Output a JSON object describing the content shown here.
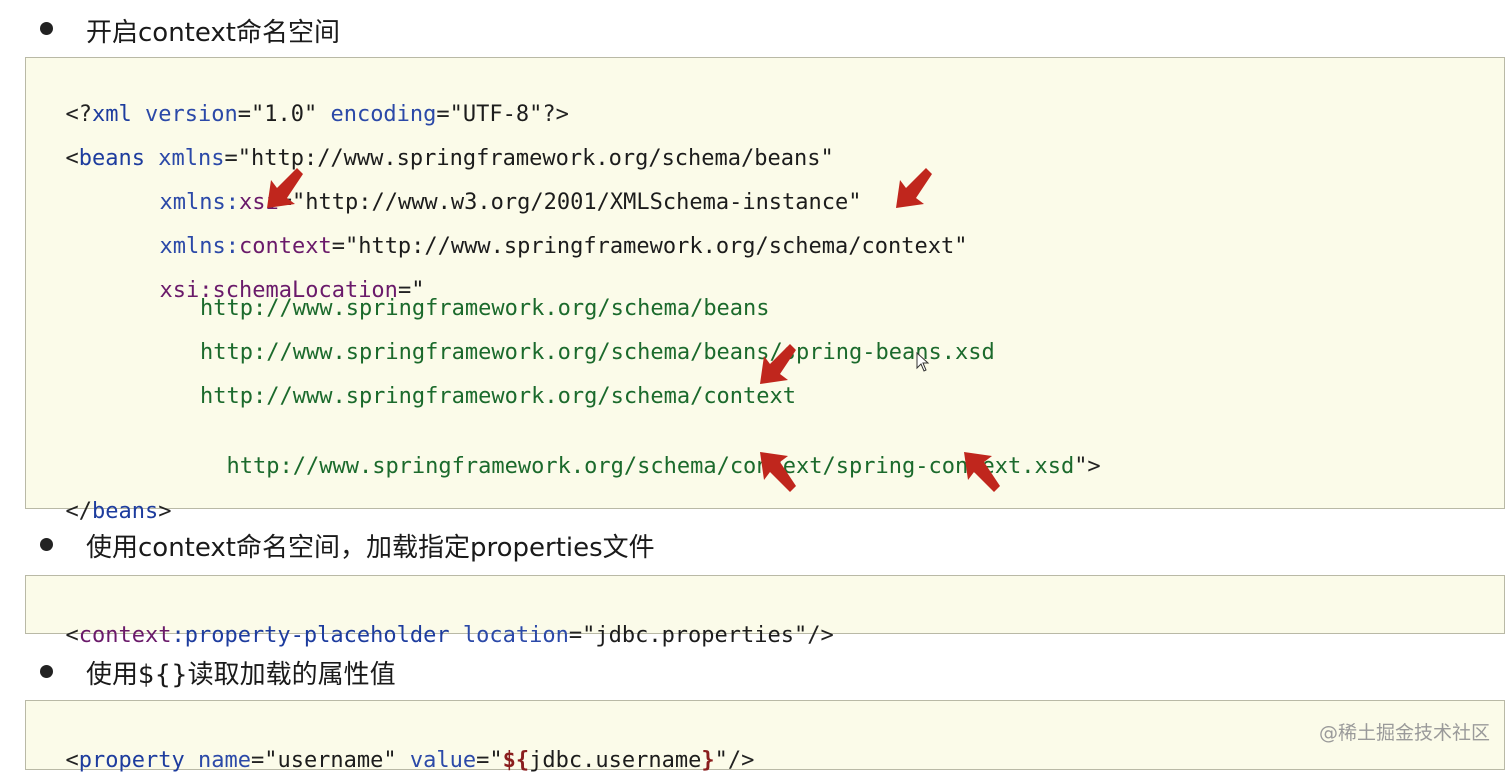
{
  "bullets": [
    {
      "text": "开启context命名空间"
    },
    {
      "text": "使用context命名空间，加载指定properties文件"
    },
    {
      "text": "使用${}读取加载的属性值"
    }
  ],
  "code1": {
    "l1_open": "<?",
    "l1_tag": "xml",
    "l1_a1": "version",
    "l1_eq1": "=",
    "l1_v1": "\"1.0\"",
    "l1_a2": "encoding",
    "l1_eq2": "=",
    "l1_v2": "\"UTF-8\"",
    "l1_close": "?>",
    "l2_open": "<",
    "l2_tag": "beans",
    "l2_attr": "xmlns",
    "l2_eq": "=",
    "l2_val": "\"http://www.springframework.org/schema/beans\"",
    "l3_attr": "xmlns:",
    "l3_ns": "xsi",
    "l3_eq": "=",
    "l3_val": "\"http://www.w3.org/2001/XMLSchema-instance\"",
    "l4_attr": "xmlns:",
    "l4_ns": "context",
    "l4_eq": "=",
    "l4_val": "\"http://www.springframework.org/schema/context\"",
    "l5_ns": "xsi",
    "l5_attr": ":schemaLocation",
    "l5_eq": "=",
    "l5_q": "\"",
    "l6_url": "http://www.springframework.org/schema/beans",
    "l7_url": "http://www.springframework.org/schema/beans/spring-beans.xsd",
    "l8_url": "http://www.springframework.org/schema/context",
    "l9_url": "http://www.springframework.org/schema/context/spring-context.xsd",
    "l9_end": "\">",
    "l10_open": "</",
    "l10_tag": "beans",
    "l10_close": ">"
  },
  "code2": {
    "open": "<",
    "ns": "context",
    "tag": ":property-placeholder",
    "attr": "location",
    "eq": "=",
    "val": "\"jdbc.properties\"",
    "close": "/>"
  },
  "code3": {
    "open": "<",
    "tag": "property",
    "a1": "name",
    "eq1": "=",
    "v1": "\"username\"",
    "a2": "value",
    "eq2": "=",
    "q1": "\"",
    "el": "${",
    "expr": "jdbc.username",
    "el_end": "}",
    "q2": "\"",
    "close": "/>"
  },
  "watermark": "@稀土掘金技术社区",
  "colors": {
    "arrow": "#c0261d",
    "code_bg": "#fbfbe9"
  },
  "icons": [
    "red-arrow-icon",
    "mouse-cursor-icon",
    "bullet-dot-icon"
  ]
}
